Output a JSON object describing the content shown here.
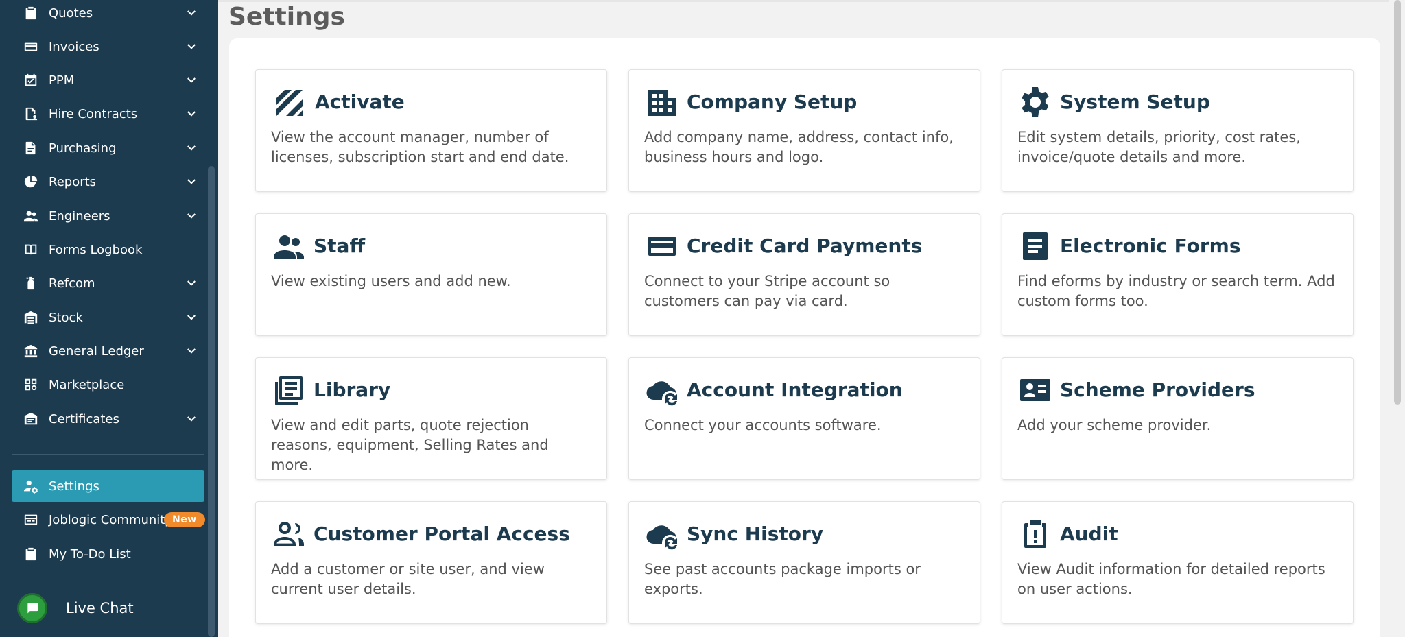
{
  "sidebar": {
    "items": [
      {
        "label": "Quotes",
        "icon": "clipboard-icon",
        "has_chevron": true
      },
      {
        "label": "Invoices",
        "icon": "credit-card-icon",
        "has_chevron": true
      },
      {
        "label": "PPM",
        "icon": "calendar-check-icon",
        "has_chevron": true
      },
      {
        "label": "Hire Contracts",
        "icon": "document-user-icon",
        "has_chevron": true
      },
      {
        "label": "Purchasing",
        "icon": "document-icon",
        "has_chevron": true
      },
      {
        "label": "Reports",
        "icon": "pie-chart-icon",
        "has_chevron": true
      },
      {
        "label": "Engineers",
        "icon": "people-icon",
        "has_chevron": true
      },
      {
        "label": "Forms Logbook",
        "icon": "book-icon",
        "has_chevron": false
      },
      {
        "label": "Refcom",
        "icon": "extinguisher-icon",
        "has_chevron": true
      },
      {
        "label": "Stock",
        "icon": "warehouse-icon",
        "has_chevron": true
      },
      {
        "label": "General Ledger",
        "icon": "bank-icon",
        "has_chevron": true
      },
      {
        "label": "Marketplace",
        "icon": "grid-icon",
        "has_chevron": false
      },
      {
        "label": "Certificates",
        "icon": "certificate-icon",
        "has_chevron": true
      }
    ],
    "bottom_items": [
      {
        "label": "Settings",
        "icon": "user-gear-icon",
        "active": true
      },
      {
        "label": "Joblogic Community",
        "icon": "community-icon",
        "badge": "New"
      },
      {
        "label": "My To-Do List",
        "icon": "checklist-icon"
      }
    ],
    "live_chat": {
      "label": "Live Chat",
      "icon": "chat-icon"
    }
  },
  "page": {
    "title": "Settings"
  },
  "cards": [
    {
      "title": "Activate",
      "icon": "activate-icon",
      "desc": "View the account manager, number of licenses, subscription start and end date."
    },
    {
      "title": "Company Setup",
      "icon": "building-icon",
      "desc": "Add company name, address, contact info, business hours and logo."
    },
    {
      "title": "System Setup",
      "icon": "gear-icon",
      "desc": "Edit system details, priority, cost rates, invoice/quote details and more."
    },
    {
      "title": "Staff",
      "icon": "people-icon",
      "desc": "View existing users and add new."
    },
    {
      "title": "Credit Card Payments",
      "icon": "credit-card-icon",
      "desc": "Connect to your Stripe account so customers can pay via card."
    },
    {
      "title": "Electronic Forms",
      "icon": "form-icon",
      "desc": "Find eforms by industry or search term. Add custom forms too."
    },
    {
      "title": "Library",
      "icon": "library-icon",
      "desc": "View and edit parts, quote rejection reasons, equipment, Selling Rates and more."
    },
    {
      "title": "Account Integration",
      "icon": "cloud-sync-icon",
      "desc": "Connect your accounts software."
    },
    {
      "title": "Scheme Providers",
      "icon": "id-card-icon",
      "desc": "Add your scheme provider."
    },
    {
      "title": "Customer Portal Access",
      "icon": "people-outline-icon",
      "desc": "Add a customer or site user, and view current user details."
    },
    {
      "title": "Sync History",
      "icon": "cloud-sync-icon",
      "desc": "See past accounts package imports or exports."
    },
    {
      "title": "Audit",
      "icon": "clipboard-alert-icon",
      "desc": "View Audit information for detailed reports on user actions."
    }
  ],
  "colors": {
    "sidebar_bg": "#1d3b4f",
    "active": "#2a9bb3",
    "badge": "#f08a2a",
    "title": "#1d3b4f"
  }
}
